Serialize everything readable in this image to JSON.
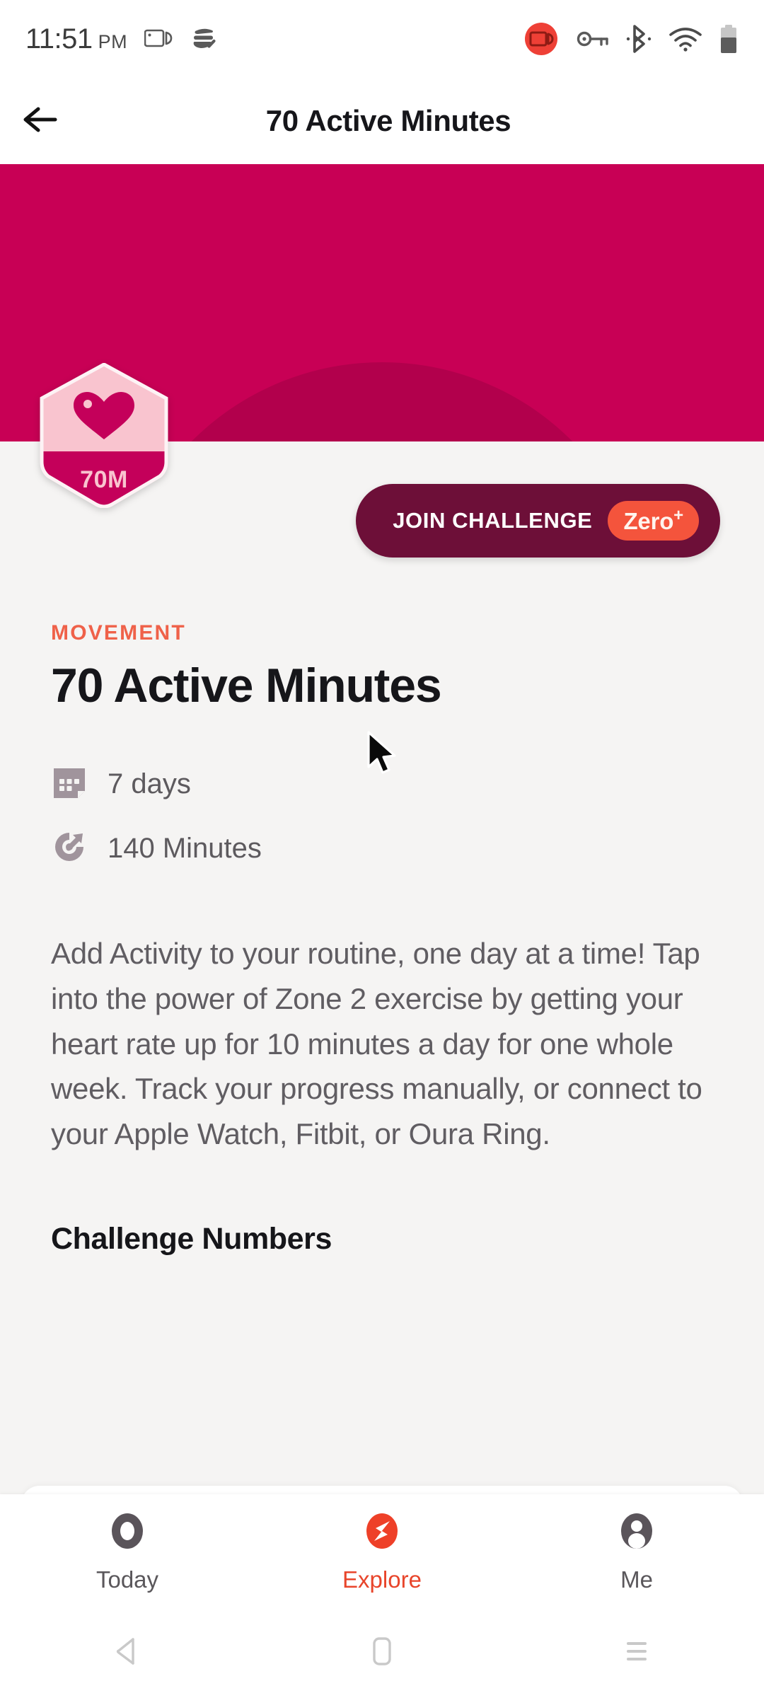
{
  "status_bar": {
    "time": "11:51",
    "ampm": "PM",
    "left_icons": [
      "screen-record-icon",
      "data-saver-check-icon"
    ],
    "right_icons": [
      "screen-recording-active-icon",
      "vpn-key-icon",
      "bluetooth-icon",
      "wifi-icon",
      "battery-icon"
    ],
    "recording_badge_color": "#ee4036"
  },
  "app_bar": {
    "back_icon": "back-arrow-icon",
    "title": "70 Active Minutes"
  },
  "hero": {
    "background_color": "#c80055",
    "arc_color": "#b2004c",
    "badge": {
      "icon": "heart-icon",
      "label": "70M",
      "top_color": "#f9c4cf",
      "bottom_color": "#c4005a"
    }
  },
  "join_button": {
    "label": "JOIN CHALLENGE",
    "badge_label": "Zero",
    "badge_superscript": "+",
    "background_color": "#6d0f38",
    "badge_color": "#f4543c"
  },
  "detail": {
    "category": "MOVEMENT",
    "category_color": "#ef6149",
    "title": "70 Active Minutes",
    "meta": [
      {
        "icon": "calendar-icon",
        "text": "7 days"
      },
      {
        "icon": "goal-target-icon",
        "text": "140 Minutes"
      }
    ],
    "description": "Add Activity to your routine, one day at a time! Tap into the power of Zone 2 exercise by getting your heart rate up for 10 minutes a day for one whole week. Track your progress manually, or connect to your Apple Watch, Fitbit, or Oura Ring.",
    "section_heading": "Challenge Numbers"
  },
  "bottom_nav": {
    "active_color": "#e8452b",
    "inactive_color": "#5a575b",
    "items": [
      {
        "label": "Today",
        "icon": "ring-circle-icon",
        "active": false
      },
      {
        "label": "Explore",
        "icon": "compass-icon",
        "active": true
      },
      {
        "label": "Me",
        "icon": "person-icon",
        "active": false
      }
    ]
  },
  "android_nav": {
    "items": [
      {
        "icon": "nav-back-triangle-icon"
      },
      {
        "icon": "nav-home-square-icon"
      },
      {
        "icon": "nav-recents-lines-icon"
      }
    ]
  },
  "cursor": {
    "icon": "mouse-pointer-icon"
  }
}
